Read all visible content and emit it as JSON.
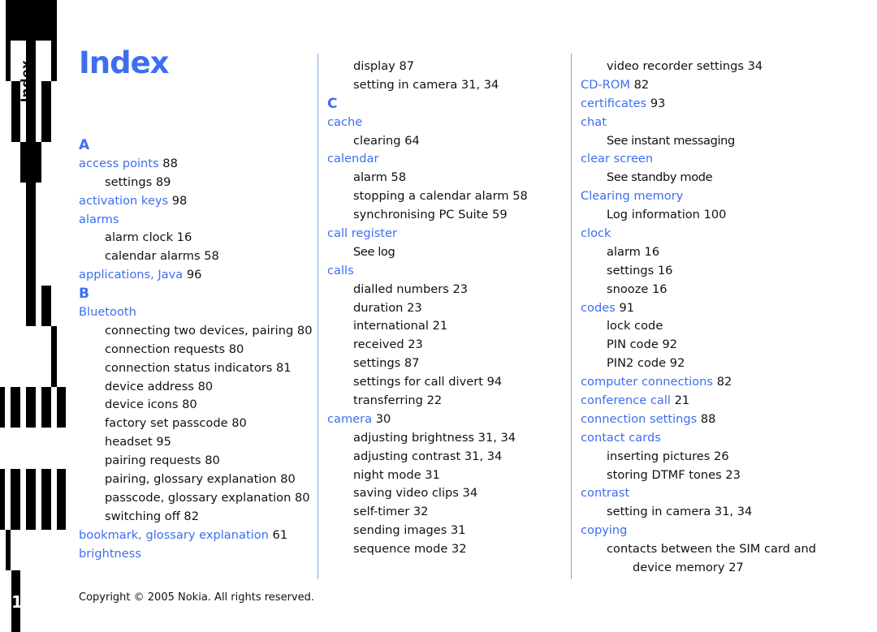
{
  "section_tab": {
    "label": "Index",
    "page_number_partial": "1"
  },
  "title": "Index",
  "columns": [
    {
      "entries": [
        {
          "type": "letter",
          "text": "A"
        },
        {
          "type": "term",
          "text": "access points",
          "pages": "88"
        },
        {
          "type": "sub",
          "text": "settings",
          "pages": "89"
        },
        {
          "type": "term",
          "text": "activation keys",
          "pages": "98"
        },
        {
          "type": "term",
          "text": "alarms",
          "pages": ""
        },
        {
          "type": "sub",
          "text": "alarm clock",
          "pages": "16"
        },
        {
          "type": "sub",
          "text": "calendar alarms",
          "pages": "58"
        },
        {
          "type": "term",
          "text": "applications, Java",
          "pages": "96"
        },
        {
          "type": "letter",
          "text": "B"
        },
        {
          "type": "term",
          "text": "Bluetooth",
          "pages": ""
        },
        {
          "type": "sub",
          "text": "connecting two devices, pairing",
          "pages": "80"
        },
        {
          "type": "sub",
          "text": "connection requests",
          "pages": "80"
        },
        {
          "type": "sub",
          "text": "connection status indicators",
          "pages": "81"
        },
        {
          "type": "sub",
          "text": "device address",
          "pages": "80"
        },
        {
          "type": "sub",
          "text": "device icons",
          "pages": "80"
        },
        {
          "type": "sub",
          "text": "factory set passcode",
          "pages": "80"
        },
        {
          "type": "sub",
          "text": "headset",
          "pages": "95"
        },
        {
          "type": "sub",
          "text": "pairing requests",
          "pages": "80"
        },
        {
          "type": "sub",
          "text": "pairing, glossary explanation",
          "pages": "80"
        },
        {
          "type": "sub",
          "text": "passcode, glossary explanation",
          "pages": "80"
        },
        {
          "type": "sub",
          "text": "switching off",
          "pages": "82"
        },
        {
          "type": "term",
          "text": "bookmark, glossary explanation",
          "pages": "61"
        },
        {
          "type": "term",
          "text": "brightness",
          "pages": ""
        }
      ]
    },
    {
      "entries": [
        {
          "type": "sub",
          "text": "display",
          "pages": "87"
        },
        {
          "type": "sub",
          "text": "setting in camera",
          "pages": "31, 34"
        },
        {
          "type": "letter",
          "text": "C"
        },
        {
          "type": "term",
          "text": "cache",
          "pages": ""
        },
        {
          "type": "sub",
          "text": "clearing",
          "pages": "64"
        },
        {
          "type": "term",
          "text": "calendar",
          "pages": ""
        },
        {
          "type": "sub",
          "text": "alarm",
          "pages": "58"
        },
        {
          "type": "sub",
          "text": "stopping a calendar alarm",
          "pages": "58"
        },
        {
          "type": "sub",
          "text": "synchronising PC Suite",
          "pages": "59"
        },
        {
          "type": "term",
          "text": "call register",
          "pages": ""
        },
        {
          "type": "sub",
          "text": "See log",
          "pages": "",
          "see": true
        },
        {
          "type": "term",
          "text": "calls",
          "pages": ""
        },
        {
          "type": "sub",
          "text": "dialled numbers",
          "pages": "23"
        },
        {
          "type": "sub",
          "text": "duration",
          "pages": "23"
        },
        {
          "type": "sub",
          "text": "international",
          "pages": "21"
        },
        {
          "type": "sub",
          "text": "received",
          "pages": "23"
        },
        {
          "type": "sub",
          "text": "settings",
          "pages": "87"
        },
        {
          "type": "sub",
          "text": "settings for call divert",
          "pages": "94"
        },
        {
          "type": "sub",
          "text": "transferring",
          "pages": "22"
        },
        {
          "type": "term",
          "text": "camera",
          "pages": "30"
        },
        {
          "type": "sub",
          "text": "adjusting brightness",
          "pages": "31, 34"
        },
        {
          "type": "sub",
          "text": "adjusting contrast",
          "pages": "31, 34"
        },
        {
          "type": "sub",
          "text": "night mode",
          "pages": "31"
        },
        {
          "type": "sub",
          "text": "saving video clips",
          "pages": "34"
        },
        {
          "type": "sub",
          "text": "self-timer",
          "pages": "32"
        },
        {
          "type": "sub",
          "text": "sending images",
          "pages": "31"
        },
        {
          "type": "sub",
          "text": "sequence mode",
          "pages": "32"
        }
      ]
    },
    {
      "entries": [
        {
          "type": "sub",
          "text": "video recorder settings",
          "pages": "34"
        },
        {
          "type": "term",
          "text": "CD-ROM",
          "pages": "82"
        },
        {
          "type": "term",
          "text": "certificates",
          "pages": "93"
        },
        {
          "type": "term",
          "text": "chat",
          "pages": ""
        },
        {
          "type": "sub",
          "text": "See instant messaging",
          "pages": "",
          "see": true
        },
        {
          "type": "term",
          "text": "clear screen",
          "pages": ""
        },
        {
          "type": "sub",
          "text": "See standby mode",
          "pages": "",
          "see": true
        },
        {
          "type": "term",
          "text": "Clearing memory",
          "pages": ""
        },
        {
          "type": "sub",
          "text": "Log information",
          "pages": "100"
        },
        {
          "type": "term",
          "text": "clock",
          "pages": ""
        },
        {
          "type": "sub",
          "text": "alarm",
          "pages": "16"
        },
        {
          "type": "sub",
          "text": "settings",
          "pages": "16"
        },
        {
          "type": "sub",
          "text": "snooze",
          "pages": "16"
        },
        {
          "type": "term",
          "text": "codes",
          "pages": "91"
        },
        {
          "type": "sub",
          "text": "lock code",
          "pages": ""
        },
        {
          "type": "sub",
          "text": "PIN code",
          "pages": "92"
        },
        {
          "type": "sub",
          "text": "PIN2 code",
          "pages": "92"
        },
        {
          "type": "term",
          "text": "computer connections",
          "pages": "82"
        },
        {
          "type": "term",
          "text": "conference call",
          "pages": "21"
        },
        {
          "type": "term",
          "text": "connection settings",
          "pages": "88"
        },
        {
          "type": "term",
          "text": "contact cards",
          "pages": ""
        },
        {
          "type": "sub",
          "text": "inserting pictures",
          "pages": "26"
        },
        {
          "type": "sub",
          "text": "storing DTMF tones",
          "pages": "23"
        },
        {
          "type": "term",
          "text": "contrast",
          "pages": ""
        },
        {
          "type": "sub",
          "text": "setting in camera",
          "pages": "31, 34"
        },
        {
          "type": "term",
          "text": "copying",
          "pages": ""
        },
        {
          "type": "sub",
          "text": "contacts between the SIM card and",
          "pages": ""
        },
        {
          "type": "sub2",
          "text": "device memory",
          "pages": "27"
        }
      ]
    }
  ],
  "footer": {
    "copyright": "Copyright © 2005 Nokia. All rights reserved."
  },
  "colors": {
    "accent": "#3d6ef0",
    "rule": "#7aa6e6",
    "text": "#111111",
    "tab": "#000000"
  }
}
